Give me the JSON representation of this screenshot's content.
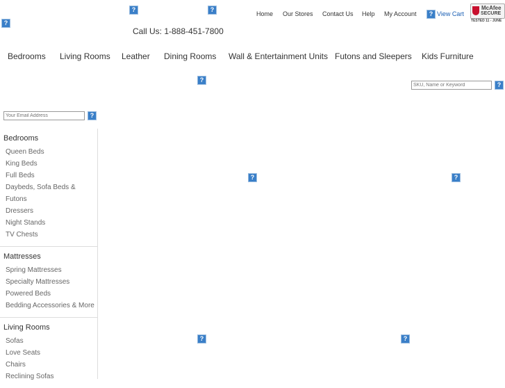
{
  "header": {
    "phone": "Call Us: 1-888-451-7800",
    "links": [
      "Home",
      "Our Stores",
      "Contact Us",
      "Help",
      "My Account"
    ],
    "view_cart": "View Cart",
    "mcafee": {
      "line1": "McAfee",
      "line2": "SECURE",
      "tested": "TESTED 11 - JUNE"
    }
  },
  "nav": [
    "Bedrooms",
    "Living Rooms",
    "Leather",
    "Dining Rooms",
    "Wall & Entertainment Units",
    "Futons and Sleepers",
    "Kids Furniture"
  ],
  "search": {
    "placeholder": "SKU, Name or Keyword"
  },
  "email": {
    "placeholder": "Your Email Address"
  },
  "broken_icon": "?",
  "sidebar": [
    {
      "title": "Bedrooms",
      "items": [
        "Queen Beds",
        "King Beds",
        "Full Beds",
        "Daybeds, Sofa Beds & Futons",
        "Dressers",
        "Night Stands",
        "TV Chests"
      ]
    },
    {
      "title": "Mattresses",
      "items": [
        "Spring Mattresses",
        "Specialty Mattresses",
        "Powered Beds",
        "Bedding Accessories & More"
      ]
    },
    {
      "title": "Living Rooms",
      "items": [
        "Sofas",
        "Love Seats",
        "Chairs",
        "Reclining Sofas"
      ]
    }
  ],
  "colors": {
    "link_blue": "#1a5fb4",
    "icon_blue": "#3a7fc8"
  }
}
